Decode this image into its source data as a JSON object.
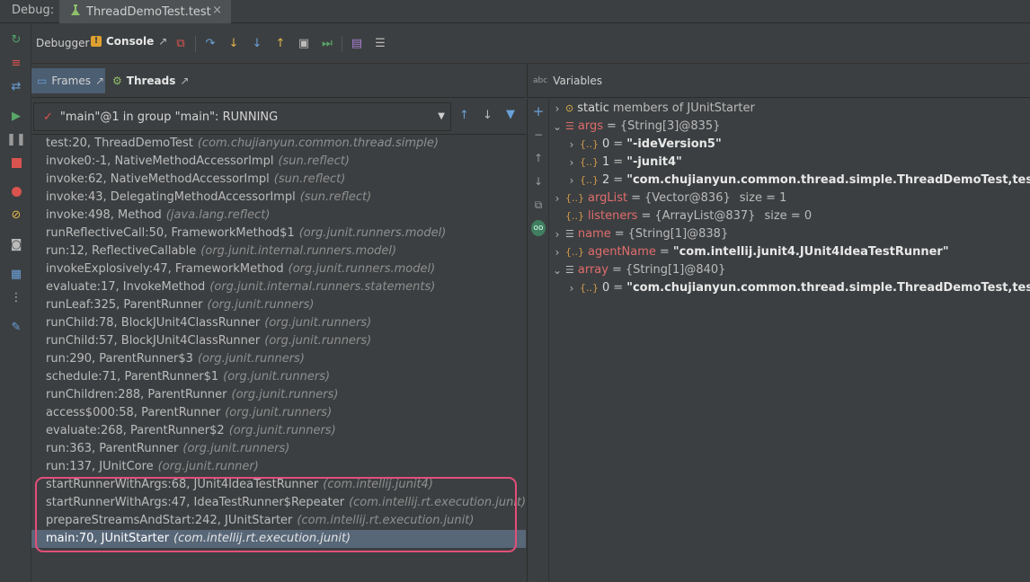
{
  "header": {
    "debug_label": "Debug:",
    "tab_title": "ThreadDemoTest.test",
    "close_glyph": "×"
  },
  "toolbar": {
    "debugger_label": "Debugger",
    "console_label": "Console"
  },
  "frames_tabs": {
    "frames_label": "Frames",
    "threads_label": "Threads"
  },
  "thread_selector": {
    "value": "\"main\"@1 in group \"main\": RUNNING"
  },
  "frames": [
    {
      "method": "test:20, ThreadDemoTest",
      "pkg": "(com.chujianyun.common.thread.simple)"
    },
    {
      "method": "invoke0:-1, NativeMethodAccessorImpl",
      "pkg": "(sun.reflect)"
    },
    {
      "method": "invoke:62, NativeMethodAccessorImpl",
      "pkg": "(sun.reflect)"
    },
    {
      "method": "invoke:43, DelegatingMethodAccessorImpl",
      "pkg": "(sun.reflect)"
    },
    {
      "method": "invoke:498, Method",
      "pkg": "(java.lang.reflect)"
    },
    {
      "method": "runReflectiveCall:50, FrameworkMethod$1",
      "pkg": "(org.junit.runners.model)"
    },
    {
      "method": "run:12, ReflectiveCallable",
      "pkg": "(org.junit.internal.runners.model)"
    },
    {
      "method": "invokeExplosively:47, FrameworkMethod",
      "pkg": "(org.junit.runners.model)"
    },
    {
      "method": "evaluate:17, InvokeMethod",
      "pkg": "(org.junit.internal.runners.statements)"
    },
    {
      "method": "runLeaf:325, ParentRunner",
      "pkg": "(org.junit.runners)"
    },
    {
      "method": "runChild:78, BlockJUnit4ClassRunner",
      "pkg": "(org.junit.runners)"
    },
    {
      "method": "runChild:57, BlockJUnit4ClassRunner",
      "pkg": "(org.junit.runners)"
    },
    {
      "method": "run:290, ParentRunner$3",
      "pkg": "(org.junit.runners)"
    },
    {
      "method": "schedule:71, ParentRunner$1",
      "pkg": "(org.junit.runners)"
    },
    {
      "method": "runChildren:288, ParentRunner",
      "pkg": "(org.junit.runners)"
    },
    {
      "method": "access$000:58, ParentRunner",
      "pkg": "(org.junit.runners)"
    },
    {
      "method": "evaluate:268, ParentRunner$2",
      "pkg": "(org.junit.runners)"
    },
    {
      "method": "run:363, ParentRunner",
      "pkg": "(org.junit.runners)"
    },
    {
      "method": "run:137, JUnitCore",
      "pkg": "(org.junit.runner)"
    },
    {
      "method": "startRunnerWithArgs:68, JUnit4IdeaTestRunner",
      "pkg": "(com.intellij.junit4)"
    },
    {
      "method": "startRunnerWithArgs:47, IdeaTestRunner$Repeater",
      "pkg": "(com.intellij.rt.execution.junit)"
    },
    {
      "method": "prepareStreamsAndStart:242, JUnitStarter",
      "pkg": "(com.intellij.rt.execution.junit)"
    },
    {
      "method": "main:70, JUnitStarter",
      "pkg": "(com.intellij.rt.execution.junit)"
    }
  ],
  "variables_header": {
    "label": "Variables"
  },
  "variables": {
    "static": {
      "name": "static",
      "value": "members of JUnitStarter"
    },
    "args": {
      "name": "args",
      "value": "{String[3]@835}"
    },
    "args_0": {
      "name": "0",
      "value": "\"-ideVersion5\""
    },
    "args_1": {
      "name": "1",
      "value": "\"-junit4\""
    },
    "args_2": {
      "name": "2",
      "value": "\"com.chujianyun.common.thread.simple.ThreadDemoTest,test\""
    },
    "argList": {
      "name": "argList",
      "value": "{Vector@836}",
      "size": "size = 1"
    },
    "listeners": {
      "name": "listeners",
      "value": "{ArrayList@837}",
      "size": "size = 0"
    },
    "name": {
      "name": "name",
      "value": "{String[1]@838}"
    },
    "agentName": {
      "name": "agentName",
      "value": "\"com.intellij.junit4.JUnit4IdeaTestRunner\""
    },
    "array": {
      "name": "array",
      "value": "{String[1]@840}"
    },
    "array_0": {
      "name": "0",
      "value": "\"com.chujianyun.common.thread.simple.ThreadDemoTest,test\""
    },
    "equals": "="
  },
  "colors": {
    "accent_blue": "#4b6eaf",
    "highlight_pink": "#e34f7a",
    "selected_row": "#576778"
  }
}
